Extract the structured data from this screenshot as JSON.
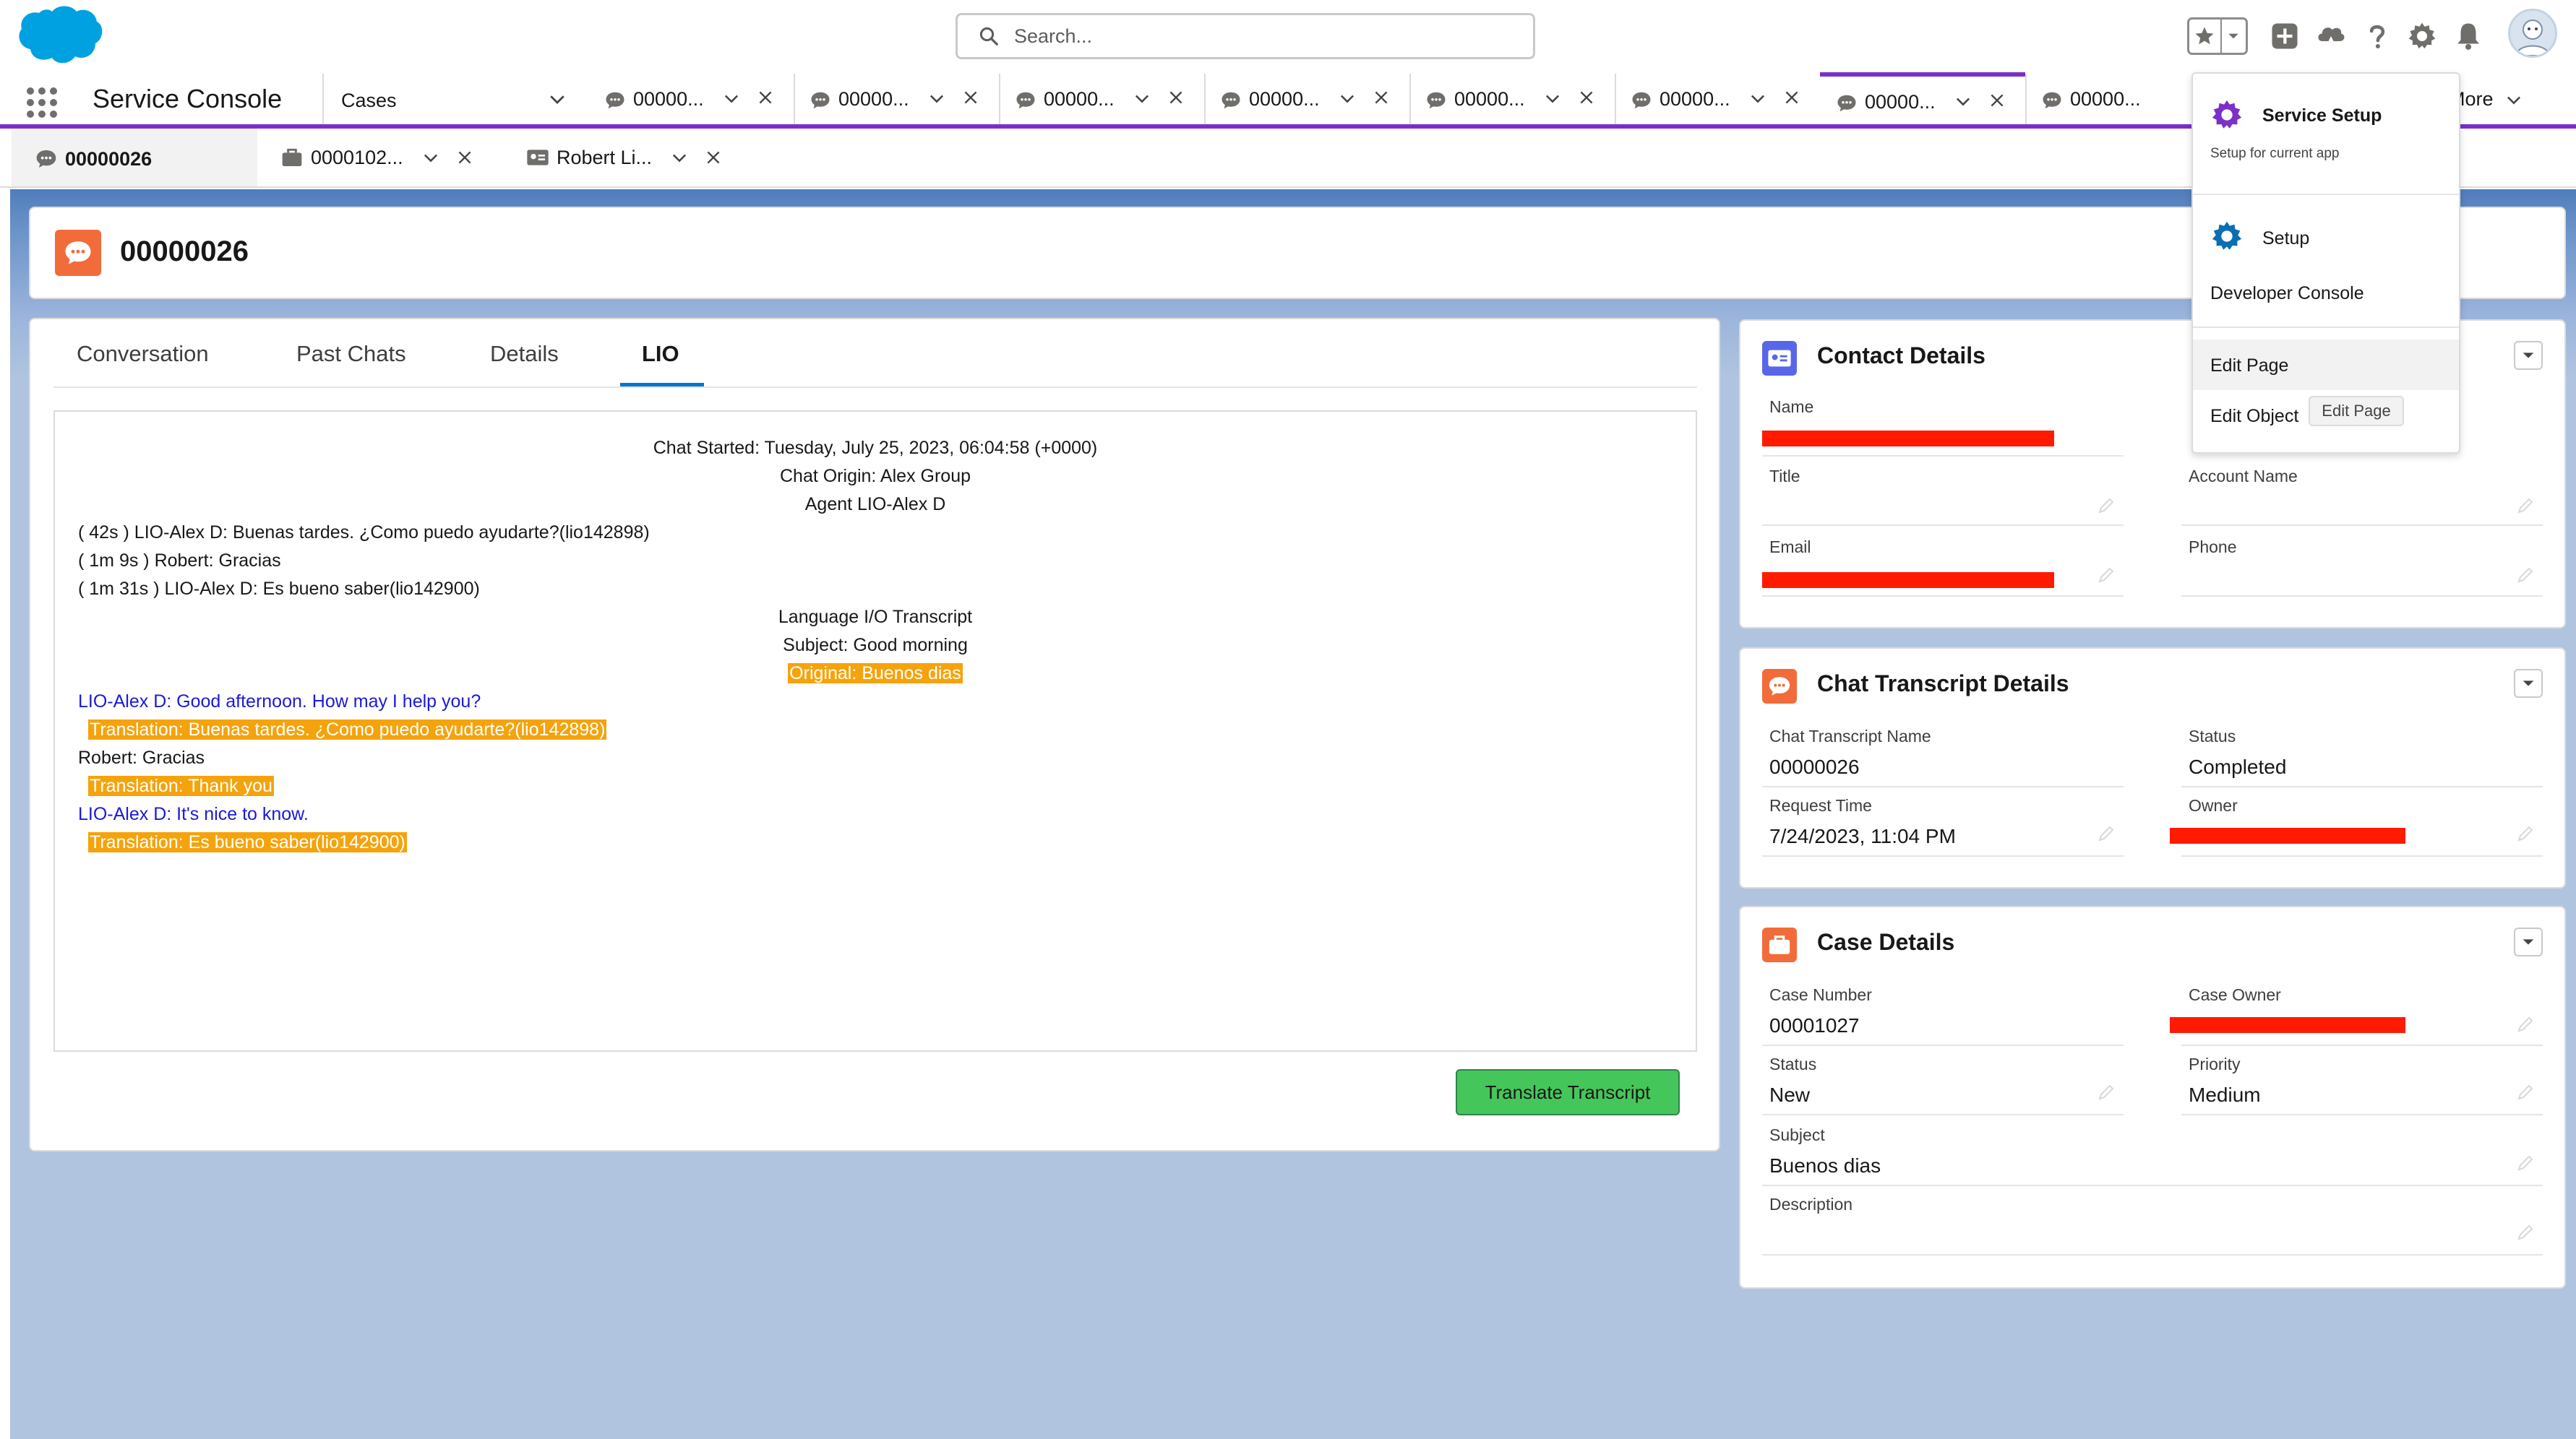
{
  "search": {
    "placeholder": "Search..."
  },
  "nav": {
    "app_name": "Service Console",
    "object_tab": "Cases",
    "tabs": [
      {
        "label": "00000..."
      },
      {
        "label": "00000..."
      },
      {
        "label": "00000..."
      },
      {
        "label": "00000..."
      },
      {
        "label": "00000..."
      },
      {
        "label": "00000..."
      },
      {
        "label": "00000..."
      },
      {
        "label": "00000..."
      }
    ],
    "more": "More"
  },
  "subtabs": [
    {
      "label": "00000026"
    },
    {
      "label": "0000102..."
    },
    {
      "label": "Robert Li..."
    }
  ],
  "record": {
    "title": "00000026"
  },
  "main_tabs": {
    "conversation": "Conversation",
    "past_chats": "Past Chats",
    "details": "Details",
    "lio": "LIO"
  },
  "transcript": {
    "started": "Chat Started: Tuesday, July 25, 2023, 06:04:58 (+0000)",
    "origin": "Chat Origin: Alex Group",
    "agent": "Agent LIO-Alex D",
    "line1": "( 42s ) LIO-Alex D: Buenas tardes. ¿Como puedo ayudarte?(lio142898)",
    "line2": "( 1m 9s ) Robert: Gracias",
    "line3": "( 1m 31s ) LIO-Alex D: Es bueno saber(lio142900)",
    "lio_title": "Language I/O Transcript",
    "subject": "Subject: Good morning",
    "original": "Original: Buenos dias",
    "msg1": "LIO-Alex D: Good afternoon. How may I help you?",
    "trans1": "Translation: Buenas tardes. ¿Como puedo ayudarte?(lio142898)",
    "msg2": "Robert: Gracias",
    "trans2": "Translation: Thank you",
    "msg3": "LIO-Alex D: It's nice to know.",
    "trans3": "Translation: Es bueno saber(lio142900)"
  },
  "translate_button": "Translate Transcript",
  "contact": {
    "title": "Contact Details",
    "name_label": "Name",
    "title_label": "Title",
    "account_label": "Account Name",
    "email_label": "Email",
    "phone_label": "Phone"
  },
  "chat_details": {
    "title": "Chat Transcript Details",
    "name_label": "Chat Transcript Name",
    "name_value": "00000026",
    "status_label": "Status",
    "status_value": "Completed",
    "request_label": "Request Time",
    "request_value": "7/24/2023, 11:04 PM",
    "owner_label": "Owner"
  },
  "case_details": {
    "title": "Case Details",
    "number_label": "Case Number",
    "number_value": "00001027",
    "owner_label": "Case Owner",
    "status_label": "Status",
    "status_value": "New",
    "priority_label": "Priority",
    "priority_value": "Medium",
    "subject_label": "Subject",
    "subject_value": "Buenos dias",
    "description_label": "Description"
  },
  "setup_menu": {
    "service_setup": "Service Setup",
    "service_setup_sub": "Setup for current app",
    "setup": "Setup",
    "developer_console": "Developer Console",
    "edit_page": "Edit Page",
    "edit_object": "Edit Object",
    "tooltip": "Edit Page"
  },
  "colors": {
    "brand_purple": "#7b30c8",
    "salesforce_blue": "#00a1e0",
    "chat_orange": "#f26b3a",
    "highlight_orange": "#f5a30c",
    "button_green": "#45c65a",
    "contact_blue": "#5867e8",
    "redaction_red": "#ff1a00"
  },
  "icons": [
    "salesforce-cloud-logo",
    "search-icon",
    "star-icon",
    "chevron-down-icon",
    "add-icon",
    "trailhead-icon",
    "help-icon",
    "gear-icon",
    "bell-icon",
    "app-launcher-icon",
    "chat-icon",
    "case-icon",
    "contact-card-icon",
    "close-icon",
    "pencil-icon"
  ]
}
